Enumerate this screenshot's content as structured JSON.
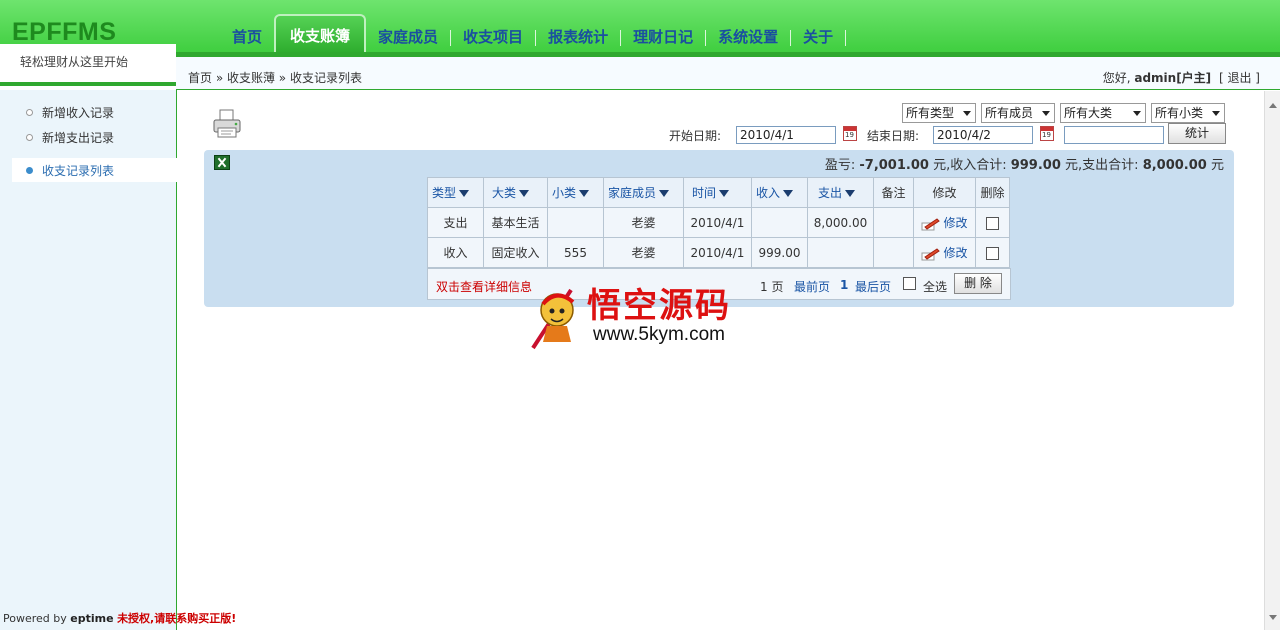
{
  "app": {
    "logo": "EPFFMS",
    "slogan": "轻松理财从这里开始"
  },
  "nav": {
    "items": [
      {
        "label": "首页",
        "active": false
      },
      {
        "label": "收支账簿",
        "active": true
      },
      {
        "label": "家庭成员",
        "active": false
      },
      {
        "label": "收支项目",
        "active": false
      },
      {
        "label": "报表统计",
        "active": false
      },
      {
        "label": "理财日记",
        "active": false
      },
      {
        "label": "系统设置",
        "active": false
      },
      {
        "label": "关于",
        "active": false
      }
    ]
  },
  "breadcrumb": "首页 » 收支账薄 » 收支记录列表",
  "user": {
    "greeting": "您好,",
    "name": "admin[户主]",
    "logout": "[ 退出 ]"
  },
  "sidebar": {
    "items": [
      {
        "label": "新增收入记录"
      },
      {
        "label": "新增支出记录"
      },
      {
        "label": "收支记录列表"
      }
    ]
  },
  "filters": {
    "type": "所有类型",
    "member": "所有成员",
    "category": "所有大类",
    "subcategory": "所有小类",
    "start_label": "开始日期:",
    "start_value": "2010/4/1",
    "end_label": "结束日期:",
    "end_value": "2010/4/2",
    "keyword_value": "",
    "stat_button": "统计",
    "calendar_num": "19"
  },
  "summary": {
    "profit_label": "盈亏:",
    "profit_value": "-7,001.00",
    "income_label": "元,收入合计:",
    "income_value": "999.00",
    "expense_label": "元,支出合计:",
    "expense_value": "8,000.00",
    "unit": "元"
  },
  "table": {
    "headers": [
      "类型",
      "大类",
      "小类",
      "家庭成员",
      "时间",
      "收入",
      "支出",
      "备注",
      "修改",
      "删除"
    ],
    "rows": [
      {
        "type": "支出",
        "category": "基本生活",
        "subcategory": "",
        "member": "老婆",
        "date": "2010/4/1",
        "income": "",
        "expense": "8,000.00",
        "note": "",
        "edit": "修改"
      },
      {
        "type": "收入",
        "category": "固定收入",
        "subcategory": "555",
        "member": "老婆",
        "date": "2010/4/1",
        "income": "999.00",
        "expense": "",
        "note": "",
        "edit": "修改"
      }
    ]
  },
  "pager": {
    "hint": "双击查看详细信息",
    "pages": "1 页",
    "first": "最前页",
    "current": "1",
    "last": "最后页",
    "select_all": "全选",
    "delete_button": "删 除"
  },
  "footer": {
    "powered": "Powered by",
    "brand": "eptime",
    "warning": "未授权,请联系购买正版!"
  },
  "watermark": {
    "title": "悟空源码",
    "url": "www.5kym.com"
  },
  "colors": {
    "header_green": "#3ccd3c",
    "panel_blue": "#c9def0",
    "link_blue": "#1a55a5",
    "warning_red": "#cc0000"
  }
}
